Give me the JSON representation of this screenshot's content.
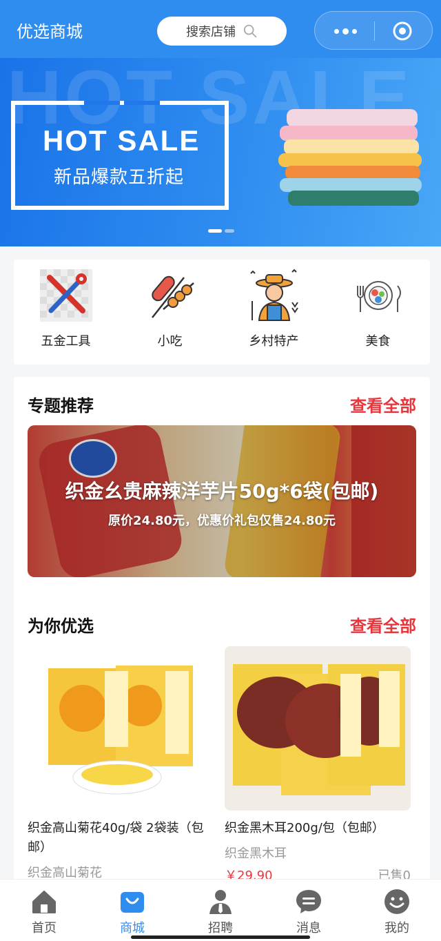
{
  "header": {
    "title": "优选商城",
    "search_label": "搜索店铺",
    "search_icon": "search-icon",
    "more_icon": "more-icon",
    "target_icon": "target-icon"
  },
  "banner": {
    "headline": "HOT SALE",
    "background_word": "HOT SALE",
    "subtitle": "新品爆款五折起",
    "slide_count": 2,
    "active_slide": 1
  },
  "categories": [
    {
      "label": "五金工具",
      "icon": "tools-icon"
    },
    {
      "label": "小吃",
      "icon": "skewer-icon"
    },
    {
      "label": "乡村特产",
      "icon": "farmer-icon"
    },
    {
      "label": "美食",
      "icon": "food-plate-icon"
    }
  ],
  "topics": {
    "title": "专题推荐",
    "more": "查看全部",
    "feature": {
      "title": "织金幺贵麻辣洋芋片50g*6袋(包邮)",
      "subtitle": "原价24.80元，优惠价礼包仅售24.80元"
    }
  },
  "picks": {
    "title": "为你优选",
    "more": "查看全部",
    "products": [
      {
        "name": "织金高山菊花40g/袋 2袋装（包邮）",
        "shop": "织金高山菊花",
        "price": "",
        "sold": ""
      },
      {
        "name": "织金黑木耳200g/包（包邮）",
        "shop": "织金黑木耳",
        "price": "￥29.90",
        "sold": "已售0"
      }
    ]
  },
  "tabbar": [
    {
      "label": "首页",
      "icon": "home-icon",
      "active": false
    },
    {
      "label": "商城",
      "icon": "shop-bag-icon",
      "active": true
    },
    {
      "label": "招聘",
      "icon": "user-tie-icon",
      "active": false
    },
    {
      "label": "消息",
      "icon": "message-icon",
      "active": false
    },
    {
      "label": "我的",
      "icon": "smile-icon",
      "active": false
    }
  ],
  "colors": {
    "primary": "#2f8df0",
    "accent_red": "#e8363d",
    "text_gray": "#999999"
  }
}
